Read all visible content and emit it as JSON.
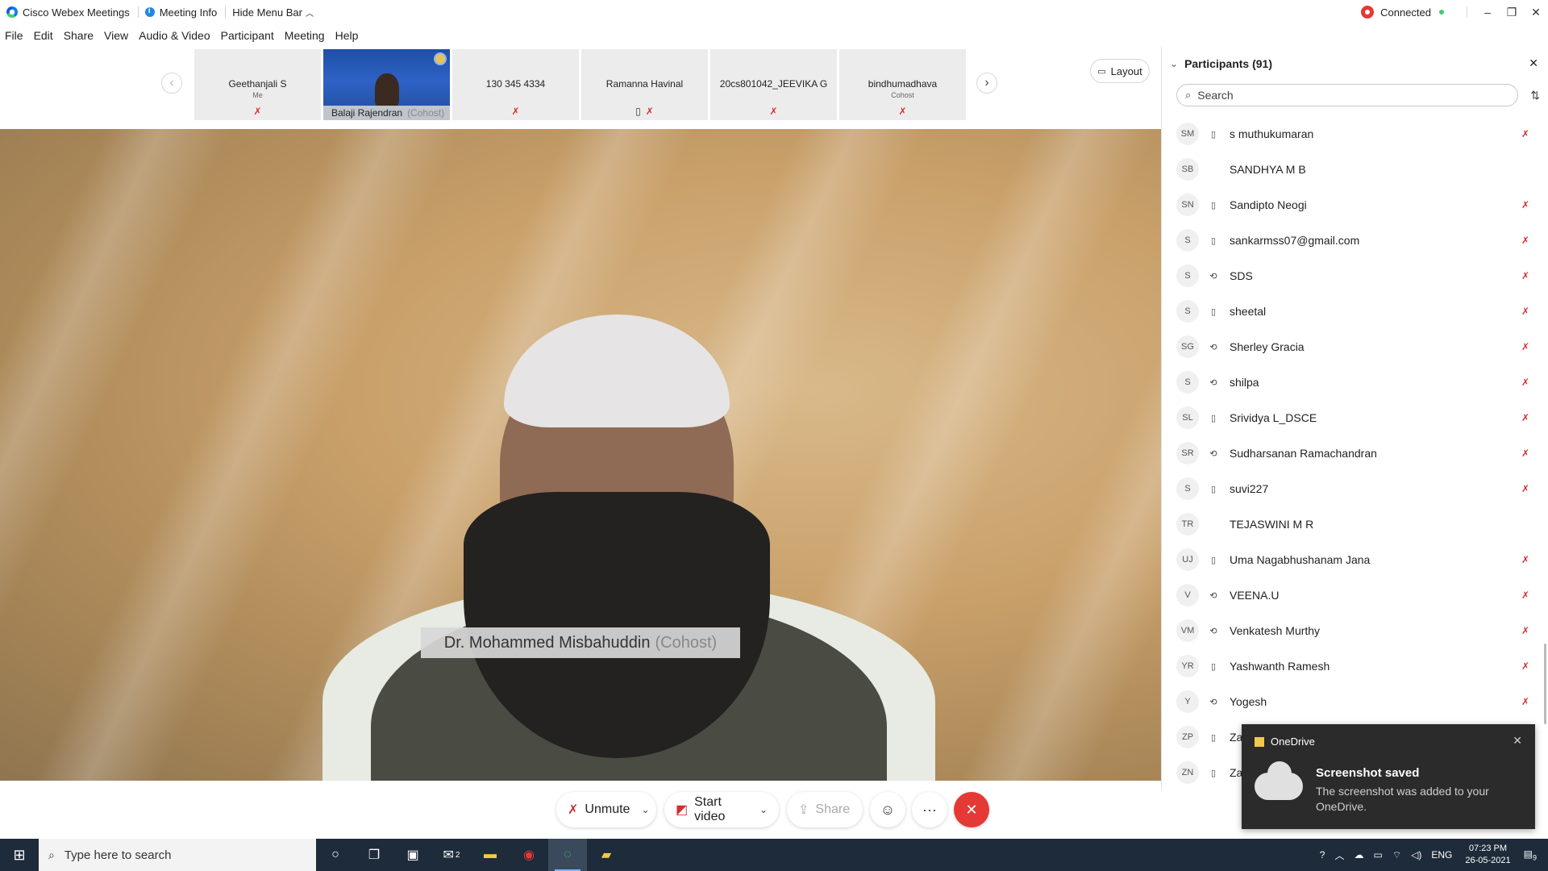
{
  "titlebar": {
    "app_name": "Cisco Webex Meetings",
    "meeting_info": "Meeting Info",
    "hide_menu": "Hide Menu Bar",
    "status": "Connected",
    "minimize": "–",
    "restore": "❐",
    "close": "✕"
  },
  "menu": [
    "File",
    "Edit",
    "Share",
    "View",
    "Audio & Video",
    "Participant",
    "Meeting",
    "Help"
  ],
  "strip": {
    "prev": "‹",
    "next": "›",
    "layout_label": "Layout",
    "tiles": [
      {
        "name": "Geethanjali S",
        "sub": "Me",
        "mic": "✗",
        "phone": ""
      },
      {
        "name": "Balaji Rajendran",
        "sub": "(Cohost)",
        "video": true
      },
      {
        "name": "130 345 4334",
        "sub": "",
        "mic": "✗",
        "phone": ""
      },
      {
        "name": "Ramanna Havinal",
        "sub": "",
        "mic": "✗",
        "phone": "▯"
      },
      {
        "name": "20cs801042_JEEVIKA G",
        "sub": "",
        "mic": "✗",
        "phone": ""
      },
      {
        "name": "bindhumadhava",
        "sub": "Cohost",
        "mic": "✗",
        "phone": ""
      }
    ]
  },
  "main_video": {
    "speaker_name": "Dr. Mohammed Misbahuddin",
    "speaker_role": "(Cohost)"
  },
  "controls": {
    "unmute": "Unmute",
    "start_video": "Start video",
    "share": "Share",
    "reactions_icon": "☺",
    "more_icon": "···",
    "end_icon": "✕"
  },
  "participants": {
    "header": "Participants (91)",
    "search_placeholder": "Search",
    "close": "✕",
    "rows": [
      {
        "initials": "SM",
        "device": "▯",
        "name": "s muthukumaran",
        "muted": true
      },
      {
        "initials": "SB",
        "device": "",
        "name": "SANDHYA M B",
        "muted": false
      },
      {
        "initials": "SN",
        "device": "▯",
        "name": "Sandipto Neogi",
        "muted": true
      },
      {
        "initials": "S",
        "device": "▯",
        "name": "sankarmss07@gmail.com",
        "muted": true
      },
      {
        "initials": "S",
        "device": "⟲",
        "name": "SDS",
        "muted": true
      },
      {
        "initials": "S",
        "device": "▯",
        "name": "sheetal",
        "muted": true
      },
      {
        "initials": "SG",
        "device": "⟲",
        "name": "Sherley Gracia",
        "muted": true
      },
      {
        "initials": "S",
        "device": "⟲",
        "name": "shilpa",
        "muted": true
      },
      {
        "initials": "SL",
        "device": "▯",
        "name": "Srividya L_DSCE",
        "muted": true
      },
      {
        "initials": "SR",
        "device": "⟲",
        "name": "Sudharsanan Ramachandran",
        "muted": true
      },
      {
        "initials": "S",
        "device": "▯",
        "name": "suvi227",
        "muted": true
      },
      {
        "initials": "TR",
        "device": "",
        "name": "TEJASWINI M R",
        "muted": false
      },
      {
        "initials": "UJ",
        "device": "▯",
        "name": "Uma Nagabhushanam Jana",
        "muted": true
      },
      {
        "initials": "V",
        "device": "⟲",
        "name": "VEENA.U",
        "muted": true
      },
      {
        "initials": "VM",
        "device": "⟲",
        "name": "Venkatesh Murthy",
        "muted": true
      },
      {
        "initials": "YR",
        "device": "▯",
        "name": "Yashwanth Ramesh",
        "muted": true
      },
      {
        "initials": "Y",
        "device": "⟲",
        "name": "Yogesh",
        "muted": true
      },
      {
        "initials": "ZP",
        "device": "▯",
        "name": "Zabi",
        "muted": false
      },
      {
        "initials": "ZN",
        "device": "▯",
        "name": "Zaib",
        "muted": false
      }
    ]
  },
  "toast": {
    "app": "OneDrive",
    "title": "Screenshot saved",
    "body": "The screenshot was added to your OneDrive.",
    "close": "✕"
  },
  "taskbar": {
    "search_placeholder": "Type here to search",
    "lang": "ENG",
    "time": "07:23 PM",
    "date": "26-05-2021",
    "notif_count": "9",
    "mail_badge": "2"
  },
  "colors": {
    "mute_red": "#d32f2f",
    "end_red": "#e53935",
    "taskbar": "#1e2b3a"
  }
}
